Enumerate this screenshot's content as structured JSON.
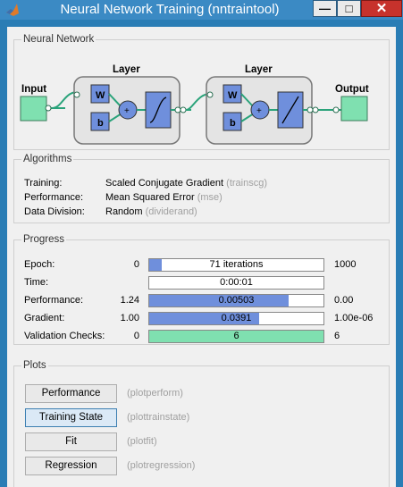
{
  "window": {
    "title": "Neural Network Training (nntraintool)",
    "minimize": "—",
    "maximize": "□",
    "close": "✕"
  },
  "network": {
    "section_title": "Neural Network",
    "input_label": "Input",
    "output_label": "Output",
    "layer1_label": "Layer",
    "layer2_label": "Layer",
    "weight_label": "W",
    "bias_label": "b",
    "sum_symbol": "+",
    "colors": {
      "io_box": "#7fe0b0",
      "wb_box": "#6f8fdc",
      "connector": "#2aa37a"
    }
  },
  "algorithms": {
    "section_title": "Algorithms",
    "rows": [
      {
        "label": "Training:",
        "value": "Scaled Conjugate Gradient",
        "code": "(trainscg)"
      },
      {
        "label": "Performance:",
        "value": "Mean Squared Error",
        "code": "(mse)"
      },
      {
        "label": "Data Division:",
        "value": "Random",
        "code": "(dividerand)"
      }
    ]
  },
  "progress": {
    "section_title": "Progress",
    "rows": [
      {
        "label": "Epoch:",
        "min": "0",
        "bar_text": "71 iterations",
        "max": "1000",
        "fill": 0.071,
        "color": "#6f8fdc"
      },
      {
        "label": "Time:",
        "min": "",
        "bar_text": "0:00:01",
        "max": "",
        "fill": 0,
        "color": "#6f8fdc"
      },
      {
        "label": "Performance:",
        "min": "1.24",
        "bar_text": "0.00503",
        "max": "0.00",
        "fill": 0.8,
        "color": "#6f8fdc"
      },
      {
        "label": "Gradient:",
        "min": "1.00",
        "bar_text": "0.0391",
        "max": "1.00e-06",
        "fill": 0.63,
        "color": "#6f8fdc"
      },
      {
        "label": "Validation Checks:",
        "min": "0",
        "bar_text": "6",
        "max": "6",
        "fill": 1.0,
        "color": "#7fe0b0"
      }
    ]
  },
  "plots": {
    "section_title": "Plots",
    "buttons": [
      {
        "label": "Performance",
        "code": "(plotperform)"
      },
      {
        "label": "Training State",
        "code": "(plottrainstate)"
      },
      {
        "label": "Fit",
        "code": "(plotfit)"
      },
      {
        "label": "Regression",
        "code": "(plotregression)"
      }
    ]
  }
}
